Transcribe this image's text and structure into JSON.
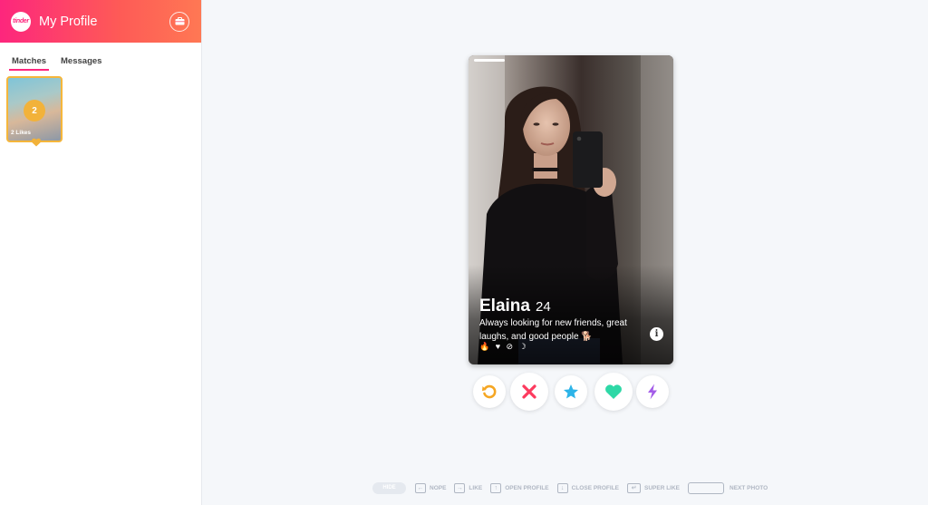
{
  "sidebar": {
    "logo_text": "tinder",
    "title": "My Profile",
    "briefcase_icon": "briefcase-icon",
    "tabs": [
      {
        "label": "Matches",
        "active": true
      },
      {
        "label": "Messages",
        "active": false
      }
    ],
    "likes": {
      "count": "2",
      "label": "2 Likes"
    }
  },
  "card": {
    "name": "Elaina",
    "age": "24",
    "bio": "Always looking for new friends, great laughs, and good people 🐕",
    "interests": "🔥 ♥ ⊘ ☽",
    "photo_count_indicator": "1"
  },
  "actions": {
    "rewind_icon": "rewind-icon",
    "nope_icon": "close-icon",
    "superlike_icon": "star-icon",
    "like_icon": "heart-icon",
    "boost_icon": "lightning-icon"
  },
  "hints": {
    "hide": "HIDE",
    "nope": "NOPE",
    "like": "LIKE",
    "open_profile": "OPEN PROFILE",
    "close_profile": "CLOSE PROFILE",
    "super_like": "SUPER LIKE",
    "next_photo": "NEXT PHOTO"
  },
  "colors": {
    "brand_gradient_start": "#fd267d",
    "brand_gradient_end": "#ff7854",
    "rewind": "#f5a623",
    "nope": "#fd3a5e",
    "superlike": "#2db4e8",
    "like": "#2ed8a6",
    "boost": "#a35ce8",
    "gold": "#f2b23a"
  }
}
